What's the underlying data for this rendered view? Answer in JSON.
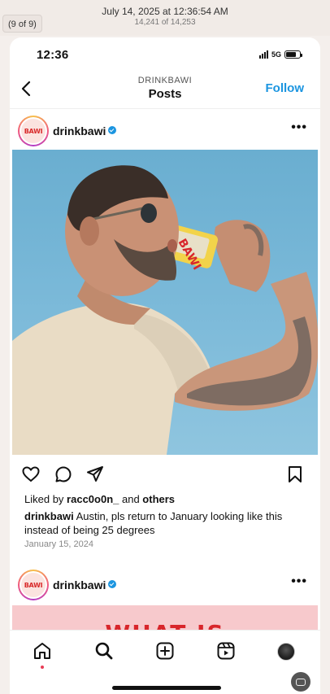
{
  "viewer": {
    "counter": "(9 of 9)",
    "date": "July 14, 2025 at 12:36:54 AM",
    "index": "14,241 of 14,253"
  },
  "status_bar": {
    "time": "12:36",
    "network": "5G",
    "battery_level": 0.75
  },
  "header": {
    "account": "DRINKBAWI",
    "title": "Posts",
    "follow_label": "Follow"
  },
  "post": {
    "username": "drinkbawi",
    "avatar_text": "BAWI",
    "image_alt": "Man drinking a can of BAWI",
    "liked_by_prefix": "Liked by ",
    "liked_by_user": "racc0o0n_",
    "liked_by_middle": " and ",
    "liked_by_others": "others",
    "caption_user": "drinkbawi",
    "caption_text": " Austin, pls return to January looking like this instead of being 25 degrees",
    "date": "January 15, 2024"
  },
  "next_post": {
    "username": "drinkbawi",
    "avatar_text": "BAWI",
    "preview_text": "WHAT IS"
  },
  "tabs": [
    "home",
    "search",
    "create",
    "reels",
    "profile"
  ],
  "colors": {
    "accent": "#1b95e0",
    "notification": "#e83c55",
    "brand_red": "#d8262b"
  }
}
